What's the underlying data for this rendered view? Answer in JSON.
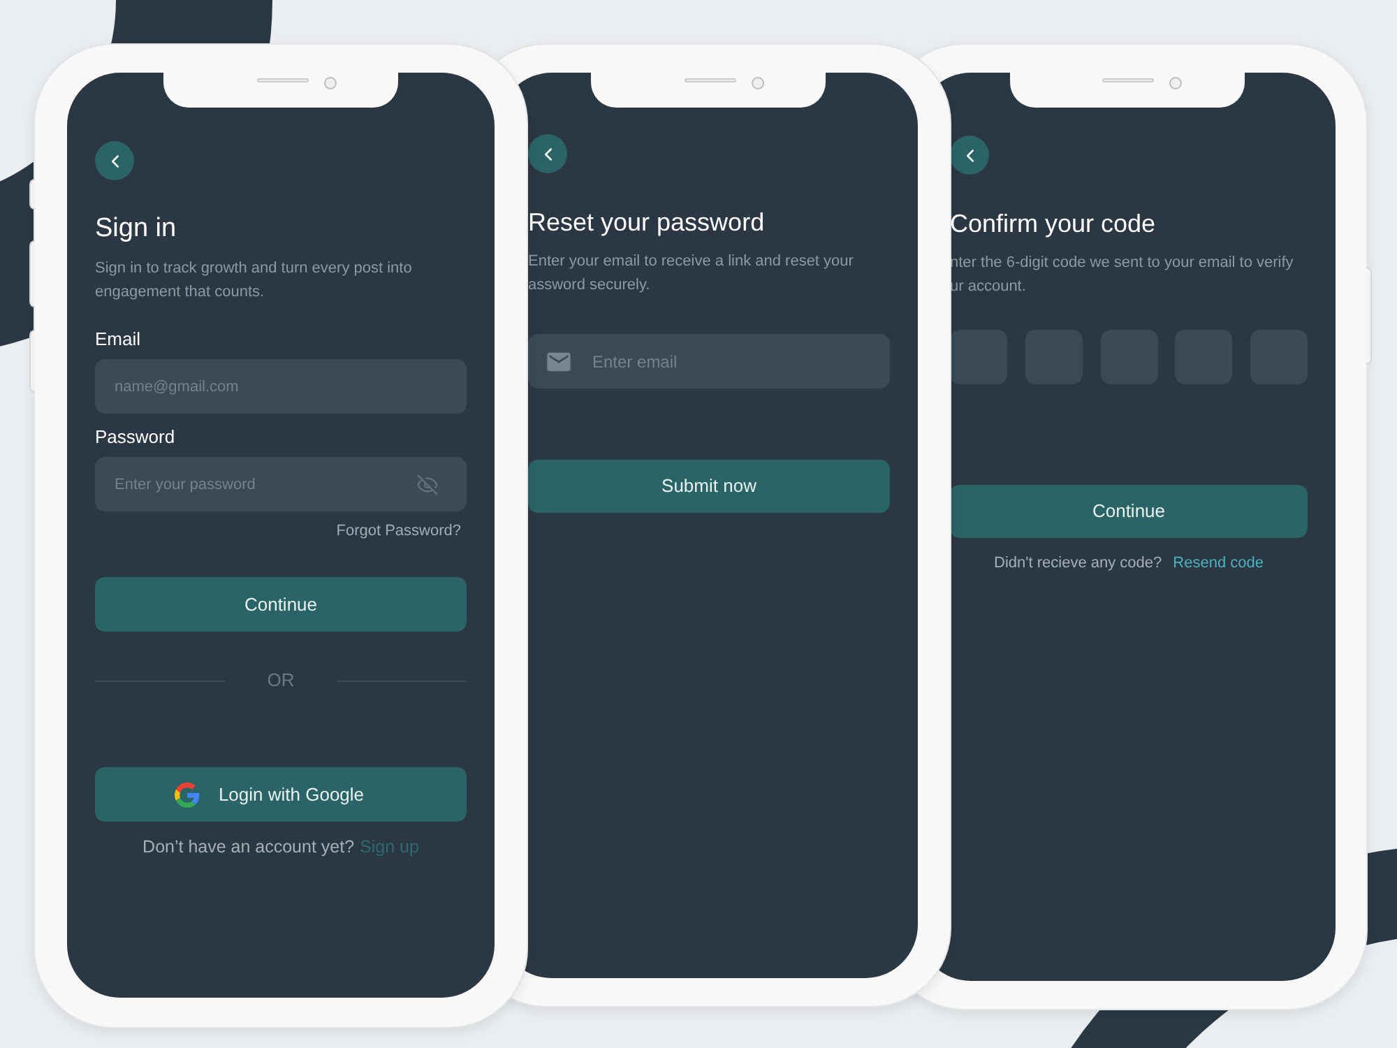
{
  "screens": [
    {
      "kind": "sign_in",
      "title": "Sign in",
      "description": "Sign in to track growth and turn every post into engagement that counts.",
      "fields": [
        {
          "kind": "text",
          "label": "Email",
          "placeholder": "name@gmail.com"
        },
        {
          "kind": "password",
          "label": "Password",
          "placeholder": "Enter your password"
        }
      ],
      "forgot_link": "Forgot Password?",
      "primary_button": "Continue",
      "divider": "OR",
      "social_button": "Login with Google",
      "footer": {
        "prompt": "Don’t have an account yet?",
        "link": "Sign up"
      }
    },
    {
      "kind": "reset",
      "title": "Reset your password",
      "description": "Enter your email to receive a link and reset your\nassword securely.",
      "fields": [
        {
          "kind": "email",
          "placeholder": "Enter email"
        }
      ],
      "primary_button": "Submit now"
    },
    {
      "kind": "verify",
      "title": "Confirm your code",
      "description": "nter the 6-digit code we sent to your email to verify\nur account.",
      "code_fields": [
        {
          "filled": false
        },
        {
          "filled": false
        },
        {
          "filled": false
        },
        {
          "filled": false
        },
        {
          "filled": false
        }
      ],
      "primary_button": "Continue",
      "footer": {
        "prompt": "Didn't recieve any code?",
        "link": "Resend code"
      }
    }
  ]
}
